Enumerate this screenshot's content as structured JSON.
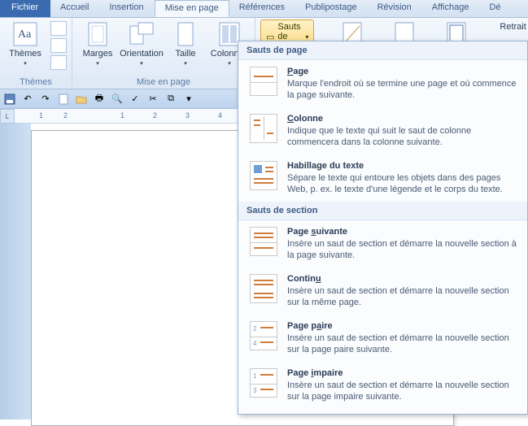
{
  "tabs": {
    "file": "Fichier",
    "home": "Accueil",
    "insert": "Insertion",
    "layout": "Mise en page",
    "references": "Références",
    "mailings": "Publipostage",
    "review": "Révision",
    "view": "Affichage",
    "dev": "Dé"
  },
  "ribbon": {
    "themes": {
      "label": "Thèmes",
      "group": "Thèmes"
    },
    "margins": "Marges",
    "orientation": "Orientation",
    "size": "Taille",
    "columns": "Colonnes",
    "pagesetup_group": "Mise en page",
    "breaks_btn": "Sauts de pages",
    "indent": "Retrait"
  },
  "ruler": {
    "t0": "1",
    "t1": "2",
    "t2": "1",
    "t3": "2",
    "t4": "3",
    "t5": "4"
  },
  "dropdown": {
    "header1": "Sauts de page",
    "header2": "Sauts de section",
    "items1": [
      {
        "title": "Page",
        "desc": "Marque l'endroit où se termine une page et où commence la page suivante."
      },
      {
        "title": "Colonne",
        "desc": "Indique que le texte qui suit le saut de colonne commencera dans la colonne suivante."
      },
      {
        "title": "Habillage du texte",
        "desc": "Sépare le texte qui entoure les objets dans des pages Web, p. ex. le texte d'une légende et le corps du texte."
      }
    ],
    "items2": [
      {
        "title": "Page suivante",
        "desc": "Insère un saut de section et démarre la nouvelle section à la page suivante."
      },
      {
        "title": "Continu",
        "desc": "Insère un saut de section et démarre la nouvelle section sur la même page."
      },
      {
        "title": "Page paire",
        "desc": "Insère un saut de section et démarre la nouvelle section sur la page paire suivante."
      },
      {
        "title": "Page impaire",
        "desc": "Insère un saut de section et démarre la nouvelle section sur la page impaire suivante."
      }
    ]
  }
}
